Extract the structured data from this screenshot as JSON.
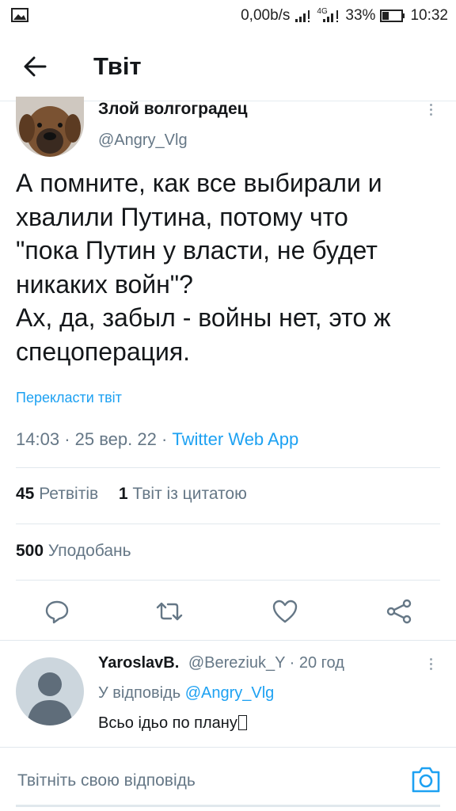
{
  "status_bar": {
    "network_speed": "0,00b/s",
    "network_type": "4G",
    "battery": "33%",
    "time": "10:32"
  },
  "header": {
    "title": "Твіт"
  },
  "tweet": {
    "author_name": "Злой волгоградец",
    "author_handle": "@Angry_Vlg",
    "text_lines": [
      "А помните, как все выбирали и",
      "хвалили Путина, потому что",
      "\"пока Путин у власти, не будет",
      "никаких войн\"?",
      "Ах, да, забыл - войны нет, это ж",
      "спецоперация."
    ],
    "translate_label": "Перекласти твіт",
    "time": "14:03",
    "date": "25 вер. 22",
    "source": "Twitter Web App",
    "separator": "·",
    "retweets_count": "45",
    "retweets_label": "Ретвітів",
    "quotes_count": "1",
    "quotes_label": "Твіт із цитатою",
    "likes_count": "500",
    "likes_label": "Уподобань"
  },
  "reply": {
    "author_name": "YaroslavB.",
    "author_handle": "@Bereziuk_Y",
    "separator": "·",
    "age": "20 год",
    "replying_to_label": "У відповідь",
    "replying_to_handle": "@Angry_Vlg",
    "text": "Всьо ідьо по плану"
  },
  "compose": {
    "placeholder": "Твітніть свою відповідь"
  },
  "icons": {
    "back": "arrow-left-icon",
    "more": "more-vertical-icon",
    "reply": "reply-icon",
    "retweet": "retweet-icon",
    "like": "heart-icon",
    "share": "share-icon",
    "camera": "camera-icon"
  },
  "colors": {
    "accent": "#1da1f2",
    "secondary_text": "#657786",
    "primary_text": "#14171a",
    "divider": "#e1e8ed",
    "action_icon": "#657786"
  }
}
